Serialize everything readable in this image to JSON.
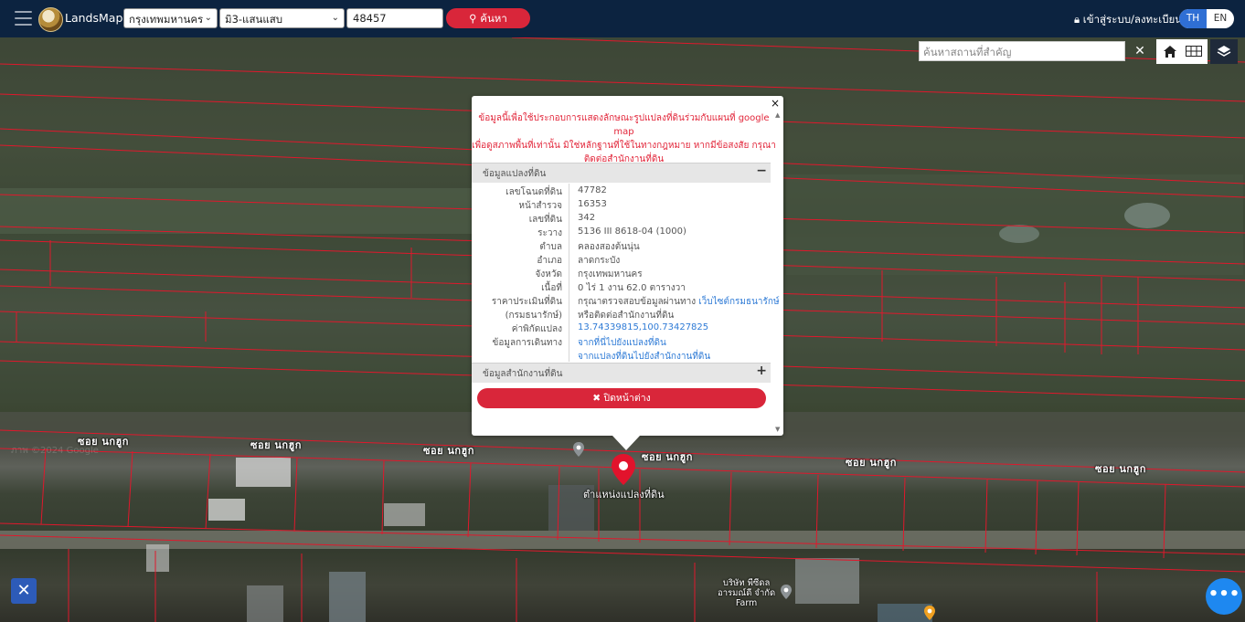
{
  "header": {
    "brand": "LandsMaps",
    "province_select": "กรุงเทพมหานคร",
    "district_select": "มิ3-แสนแสบ",
    "parcel_number": "48457",
    "search_button": "ค้นหา",
    "login_link": "เข้าสู่ระบบ/ลงทะเบียน",
    "lang_th": "TH",
    "lang_en": "EN"
  },
  "map_controls": {
    "place_search_placeholder": "ค้นหาสถานที่สำคัญ",
    "clear": "✕",
    "home_icon": "home-icon",
    "grid_icon": "grid-icon",
    "layers_icon": "layers-icon"
  },
  "map": {
    "road_label": "ซอย นกฮูก",
    "marker_label": "ตำแหน่งแปลงที่ดิน",
    "poi_company": "บริษัท พีซีดล\nอารมณ์ดี จำกัด\nFarm",
    "watermark": "ภาพ ©2024 Google"
  },
  "popup": {
    "close": "×",
    "disclaimer_lines": [
      "ข้อมูลนี้เพื่อใช้ประกอบการแสดงลักษณะรูปแปลงที่ดินร่วมกับแผนที่ google map",
      "เพื่อดูสภาพพื้นที่เท่านั้น มิใช่หลักฐานที่ใช้ในทางกฎหมาย หากมีข้อสงสัย กรุณา",
      "ติดต่อสำนักงานที่ดิน"
    ],
    "section_parcel": "ข้อมูลแปลงที่ดิน",
    "section_parcel_toggle": "−",
    "rows": [
      {
        "k": "เลขโฉนดที่ดิน",
        "v": "47782"
      },
      {
        "k": "หน้าสำรวจ",
        "v": "16353"
      },
      {
        "k": "เลขที่ดิน",
        "v": "342"
      },
      {
        "k": "ระวาง",
        "v": "5136 III 8618-04 (1000)"
      },
      {
        "k": "ตำบล",
        "v": "คลองสองต้นนุ่น"
      },
      {
        "k": "อำเภอ",
        "v": "ลาดกระบัง"
      },
      {
        "k": "จังหวัด",
        "v": "กรุงเทพมหานคร"
      },
      {
        "k": "เนื้อที่",
        "v": "0 ไร่ 1 งาน 62.0 ตารางวา"
      }
    ],
    "price_label": "ราคาประเมินที่ดิน",
    "price_text": "กรุณาตรวจสอบข้อมูลผ่านทาง",
    "price_link": "เว็บไซต์กรมธนารักษ์",
    "price_label2": "(กรมธนารักษ์)",
    "price_text2": "หรือติดต่อสำนักงานที่ดิน",
    "coord_label": "ค่าพิกัดแปลง",
    "coord_value": "13.74339815,100.73427825",
    "travel_label": "ข้อมูลการเดินทาง",
    "travel_link1": "จากที่นี่ไปยังแปลงที่ดิน",
    "travel_link2": "จากแปลงที่ดินไปยังสำนักงานที่ดิน",
    "section_office": "ข้อมูลสำนักงานที่ดิน",
    "section_office_toggle": "+",
    "close_button": "✖ ปิดหน้าต่าง"
  },
  "colors": {
    "navbar": "#0c2340",
    "accent_red": "#d9263a",
    "link_blue": "#2f7bd6",
    "parcel_line": "#e0182c"
  }
}
